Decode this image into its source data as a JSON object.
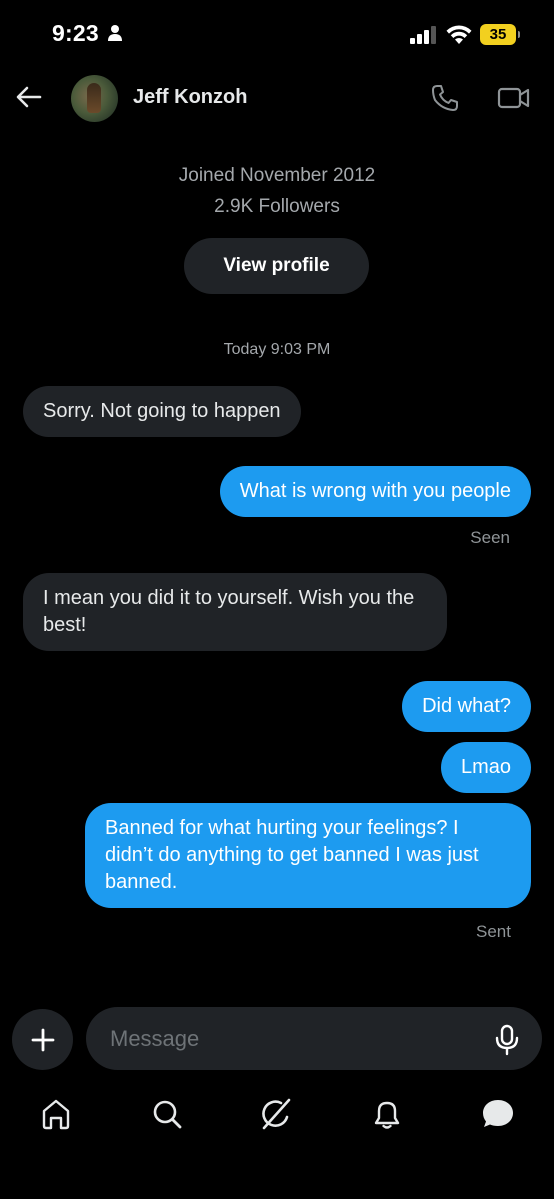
{
  "status_bar": {
    "time": "9:23",
    "battery": "35"
  },
  "header": {
    "name": "Jeff Konzoh"
  },
  "profile": {
    "joined": "Joined November 2012",
    "followers": "2.9K Followers",
    "view_profile_label": "View profile"
  },
  "conversation": {
    "timestamp": "Today 9:03 PM",
    "messages": [
      {
        "from": "them",
        "text": "Sorry. Not going to happen"
      },
      {
        "from": "me",
        "text": "What is wrong with you people"
      },
      {
        "from": "them",
        "text": "I mean you did it to yourself. Wish you the best!"
      },
      {
        "from": "me",
        "text": "Did what?"
      },
      {
        "from": "me",
        "text": "Lmao"
      },
      {
        "from": "me",
        "text": "Banned for what hurting your feelings? I didn’t do anything to get banned I was just banned."
      }
    ],
    "seen_label": "Seen",
    "sent_label": "Sent"
  },
  "composer": {
    "placeholder": "Message"
  },
  "colors": {
    "background": "#000000",
    "sent_bubble": "#1d9bf0",
    "received_bubble": "#202327",
    "battery": "#f2d01f"
  },
  "icons": {
    "back": "arrow-left-icon",
    "call": "phone-icon",
    "video": "video-icon",
    "plus": "plus-icon",
    "mic": "microphone-icon",
    "nav": [
      "home-icon",
      "search-icon",
      "grok-icon",
      "bell-icon",
      "messages-icon"
    ]
  }
}
